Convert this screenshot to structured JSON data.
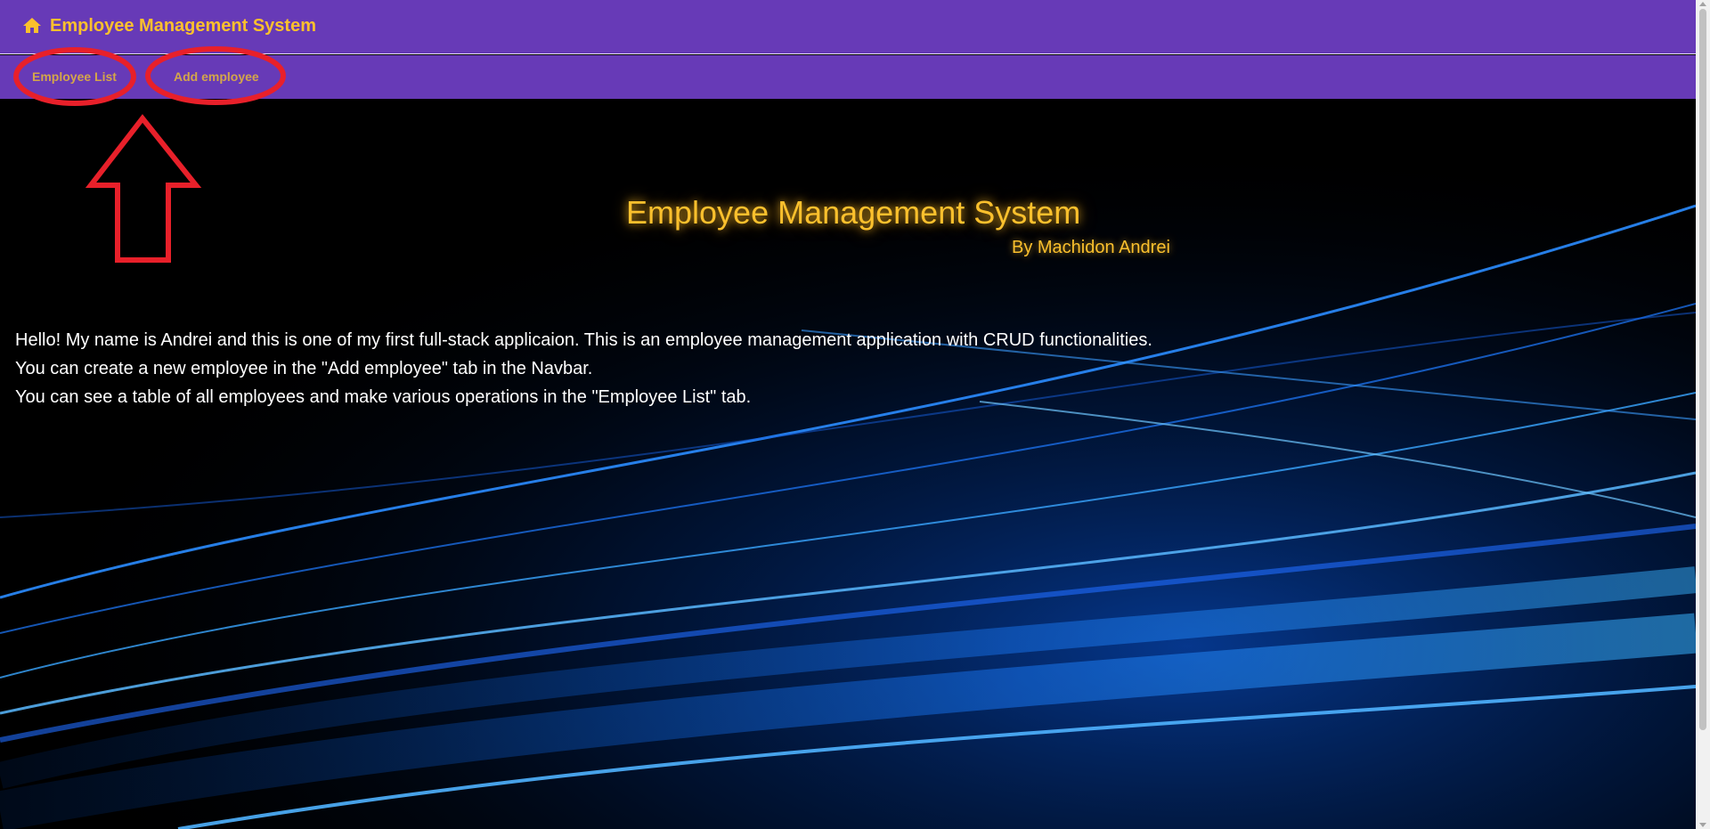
{
  "header": {
    "brand_icon": "home-icon",
    "brand_title": "Employee Management System"
  },
  "navbar": {
    "employee_list_label": "Employee List",
    "add_employee_label": "Add employee"
  },
  "hero": {
    "title": "Employee Management System",
    "subtitle": "By Machidon Andrei"
  },
  "intro": {
    "line1": "Hello! My name is Andrei and this is one of my first full-stack applicaion. This is an employee management application with CRUD functionalities.",
    "line2": "You can create a new employee in the \"Add employee\" tab in the Navbar.",
    "line3": "You can see a table of all employees and make various operations in the \"Employee List\" tab."
  },
  "colors": {
    "navbar_bg": "#673ab7",
    "accent_yellow": "#fbc02d",
    "annotation_red": "#e8202a",
    "wave_blue": "#1e90ff"
  },
  "annotations": {
    "marker_icons": [
      "red-ellipse-icon",
      "red-ellipse-icon",
      "up-arrow-icon"
    ]
  }
}
